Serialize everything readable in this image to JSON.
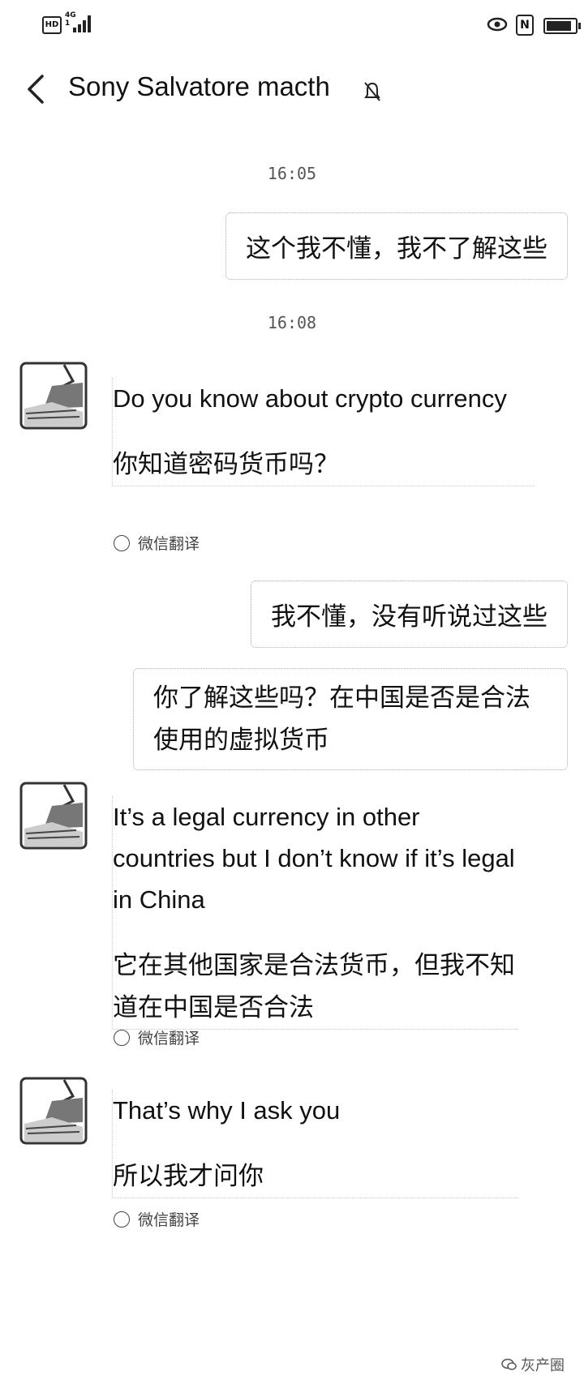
{
  "status_bar": {
    "hd": "HD",
    "network_top": "4G",
    "network_bottom": "1",
    "icons": [
      "eye-icon",
      "nfc-icon",
      "battery-icon"
    ],
    "nfc": "N"
  },
  "header": {
    "back_icon": "chevron-left-icon",
    "title": "Sony Salvatore  macth",
    "mute_icon": "muted-bell-icon"
  },
  "messages": {
    "time_1": "16:05",
    "msg_1": "这个我不懂，我不了解这些",
    "time_2": "16:08",
    "msg_2_en": "Do you know about crypto currency",
    "msg_2_zh": "你知道密码货币吗？",
    "msg_3": "我不懂，没有听说过这些",
    "msg_4": "你了解这些吗？在中国是否是合法使用的虚拟货币",
    "msg_5_en": "It’s a legal currency in other countries but I don’t know if it’s legal in China",
    "msg_5_zh": "它在其他国家是合法货币，但我不知道在中国是否合法",
    "msg_6_en": "That’s why I ask you",
    "msg_6_zh": "所以我才问你",
    "translate_label": "微信翻译"
  },
  "watermark": "灰产圈"
}
